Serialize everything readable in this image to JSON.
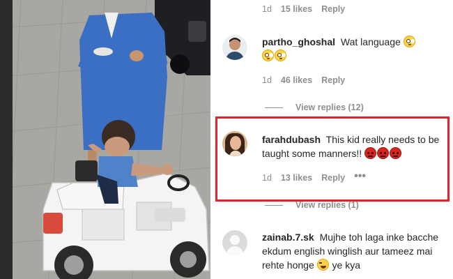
{
  "photo": {
    "description_icon": "photo-of-child-in-toy-car"
  },
  "comments": [
    {
      "id": "c0",
      "meta": {
        "time": "1d",
        "likes": "15 likes",
        "reply": "Reply"
      }
    },
    {
      "id": "c1",
      "username": "partho_ghoshal",
      "text": "Wat language",
      "emojis": [
        "flushed",
        "flushed",
        "flushed"
      ],
      "meta": {
        "time": "1d",
        "likes": "46 likes",
        "reply": "Reply"
      },
      "view_replies": "View replies (12)"
    },
    {
      "id": "c2",
      "username": "farahdubash",
      "text": "This kid really needs to be taught some manners!!",
      "emojis": [
        "angry",
        "angry",
        "angry"
      ],
      "meta": {
        "time": "1d",
        "likes": "13 likes",
        "reply": "Reply",
        "more": "•••"
      },
      "view_replies": "View replies (1)",
      "highlighted": true
    },
    {
      "id": "c3",
      "username": "zainab.7.sk",
      "text": "Mujhe toh laga inke bacche ekdum english winglish aur tameez mai rehte honge",
      "text_after": "ye kya",
      "emojis": [
        "laugh"
      ]
    }
  ],
  "colors": {
    "highlight": "#e3232b",
    "meta_gray": "#8e8e8e",
    "text": "#262626"
  }
}
